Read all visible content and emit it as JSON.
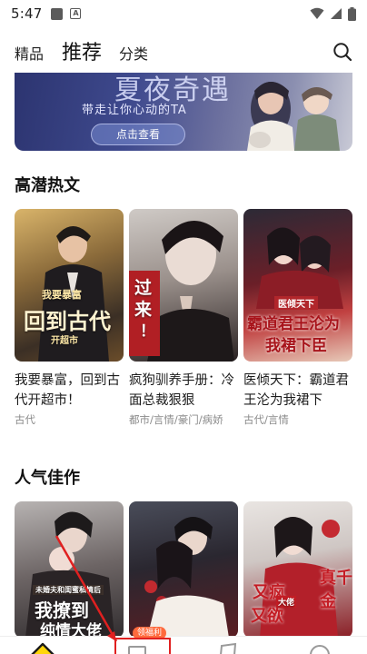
{
  "status_bar": {
    "time": "5:47"
  },
  "top_nav": {
    "tabs": [
      {
        "label": "精品"
      },
      {
        "label": "推荐"
      },
      {
        "label": "分类"
      }
    ]
  },
  "banner": {
    "title": "夏夜奇遇",
    "subtitle": "带走让你心动的TA",
    "button_label": "点击查看"
  },
  "sections": [
    {
      "title": "高潜热文",
      "books": [
        {
          "title": "我要暴富，回到古代开超市！",
          "tags": "古代",
          "cover_text": [
            "我要暴富",
            "回到古代",
            "开超市"
          ]
        },
        {
          "title": "疯狗驯养手册：冷面总裁狠狠",
          "tags": "都市/言情/豪门/病娇",
          "cover_text": [
            "过",
            "来",
            "！"
          ]
        },
        {
          "title": "医倾天下：霸道君王沦为我裙下",
          "tags": "古代/言情",
          "cover_text": [
            "医倾天下",
            "霸道君王沦为",
            "我裙下臣"
          ]
        }
      ]
    },
    {
      "title": "人气佳作",
      "books": [
        {
          "cover_text": [
            "未婚夫和闺蜜私情后",
            "我撩到",
            "纯情大佬"
          ]
        },
        {
          "cover_text": []
        },
        {
          "cover_text": [
            "又疯",
            "又欲",
            "真千金",
            "大佬"
          ]
        }
      ]
    }
  ],
  "bottom_nav": {
    "badge": "领福利"
  },
  "colors": {
    "highlight": "#ffe64d",
    "badge": "#ff6a3d",
    "annotation": "#e02020"
  }
}
